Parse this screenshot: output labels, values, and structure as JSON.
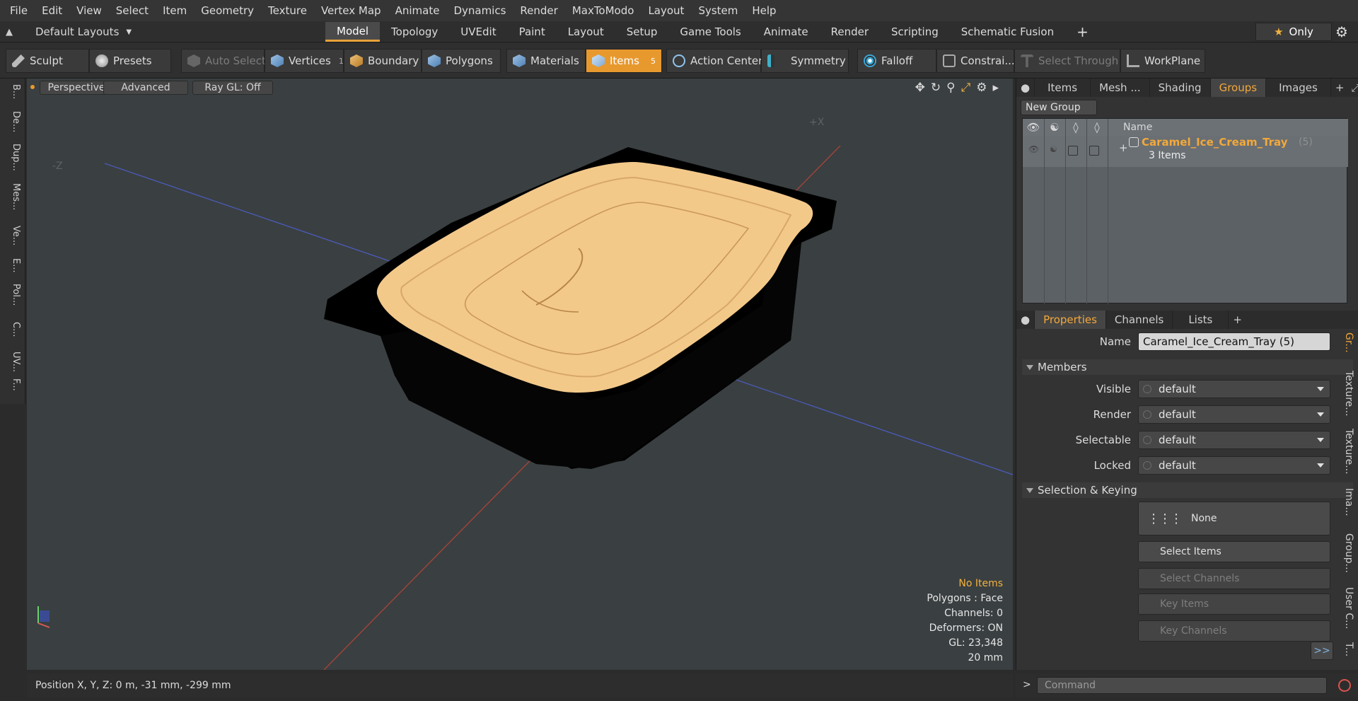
{
  "menu": [
    "File",
    "Edit",
    "View",
    "Select",
    "Item",
    "Geometry",
    "Texture",
    "Vertex Map",
    "Animate",
    "Dynamics",
    "Render",
    "MaxToModo",
    "Layout",
    "System",
    "Help"
  ],
  "layouts_label": "Default Layouts",
  "layout_tabs": [
    "Model",
    "Topology",
    "UVEdit",
    "Paint",
    "Layout",
    "Setup",
    "Game Tools",
    "Animate",
    "Render",
    "Scripting",
    "Schematic Fusion"
  ],
  "active_layout_tab": "Model",
  "only_label": "Only",
  "toolbar": {
    "sculpt": "Sculpt",
    "presets": "Presets",
    "auto_select": "Auto Select",
    "vertices": "Vertices",
    "vertices_count": "1",
    "boundary": "Boundary",
    "polygons": "Polygons",
    "materials": "Materials",
    "items": "Items",
    "items_count": "5",
    "action_center": "Action Center",
    "symmetry": "Symmetry",
    "falloff": "Falloff",
    "constraints": "Constrai...",
    "select_through": "Select Through",
    "workplane": "WorkPlane"
  },
  "left_tabs": [
    "B...",
    "De...",
    "Dup...",
    "Mes...",
    "Ve...",
    "E...",
    "Pol...",
    "C...",
    "UV...",
    "F..."
  ],
  "viewport": {
    "perspective": "Perspective",
    "advanced": "Advanced",
    "raygl": "Ray GL: Off",
    "axis_x": "+X",
    "axis_z": "-Z",
    "info": {
      "no_items": "No Items",
      "polygons": "Polygons : Face",
      "channels": "Channels: 0",
      "deformers": "Deformers: ON",
      "gl": "GL: 23,348",
      "scale": "20 mm"
    }
  },
  "status": {
    "position": "Position X, Y, Z:   0 m, -31 mm, -299 mm"
  },
  "right_top_tabs": [
    "Items",
    "Mesh ...",
    "Shading",
    "Groups",
    "Images"
  ],
  "active_right_top_tab": "Groups",
  "groups": {
    "new_group": "New Group",
    "col_name": "Name",
    "row_name": "Caramel_Ice_Cream_Tray",
    "row_count": "(5)",
    "row_sub": "3 Items"
  },
  "props_tabs": [
    "Properties",
    "Channels",
    "Lists"
  ],
  "active_props_tab": "Properties",
  "props": {
    "name_label": "Name",
    "name_value": "Caramel_Ice_Cream_Tray (5)",
    "members": "Members",
    "visible_label": "Visible",
    "render_label": "Render",
    "selectable_label": "Selectable",
    "locked_label": "Locked",
    "default": "default",
    "sel_keying": "Selection & Keying",
    "none": "None",
    "select_items": "Select Items",
    "select_channels": "Select Channels",
    "key_items": "Key Items",
    "key_channels": "Key Channels",
    "more": ">>"
  },
  "right_vtabs": [
    "Gr...",
    "Texture...",
    "Texture...",
    "Ima...",
    "Group...",
    "User C...",
    "T..."
  ],
  "command_placeholder": "Command",
  "colors": {
    "accent": "#e8992e",
    "orange_text": "#f2a83a",
    "viewport_bg": "#3a3f41",
    "ice_cream": "#f3c98a"
  }
}
